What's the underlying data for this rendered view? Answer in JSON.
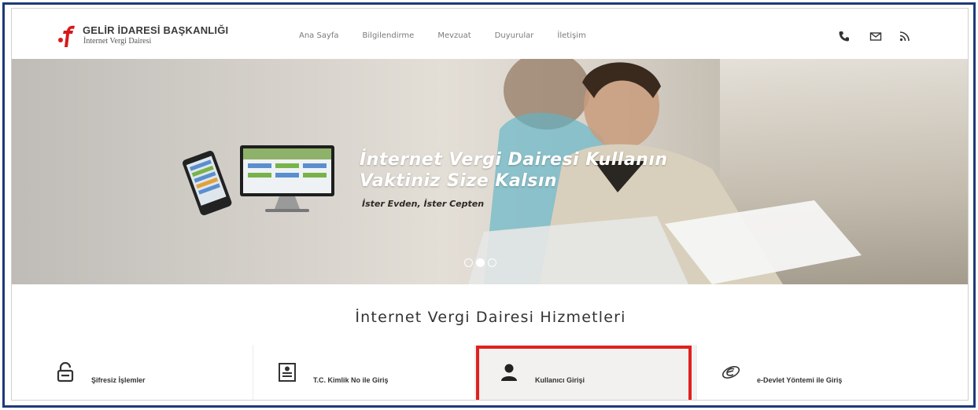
{
  "header": {
    "brand_title": "GELİR İDARESİ BAŞKANLIĞI",
    "brand_subtitle": "İnternet Vergi Dairesi",
    "nav": [
      "Ana Sayfa",
      "Bilgilendirme",
      "Mevzuat",
      "Duyurular",
      "İletişim"
    ],
    "icons": [
      "phone-icon",
      "mail-icon",
      "rss-icon"
    ]
  },
  "hero": {
    "title_line1": "İnternet Vergi Dairesi Kullanın",
    "title_line2": "Vaktiniz Size Kalsın",
    "subtitle": "İster Evden, İster Cepten",
    "slide_count": 3,
    "active_slide": 2
  },
  "services": {
    "title": "İnternet Vergi Dairesi Hizmetleri",
    "items": [
      {
        "label": "Şifresiz İşlemler",
        "icon": "unlock-icon"
      },
      {
        "label": "T.C. Kimlik No ile Giriş",
        "icon": "id-card-icon"
      },
      {
        "label": "Kullanıcı Girişi",
        "icon": "user-icon"
      },
      {
        "label": "e-Devlet Yöntemi ile Giriş",
        "icon": "e-devlet-icon"
      }
    ],
    "highlighted_index": 2
  },
  "colors": {
    "frame": "#1c3a7a",
    "brand_red": "#d7191c",
    "highlight": "#e0201f"
  }
}
